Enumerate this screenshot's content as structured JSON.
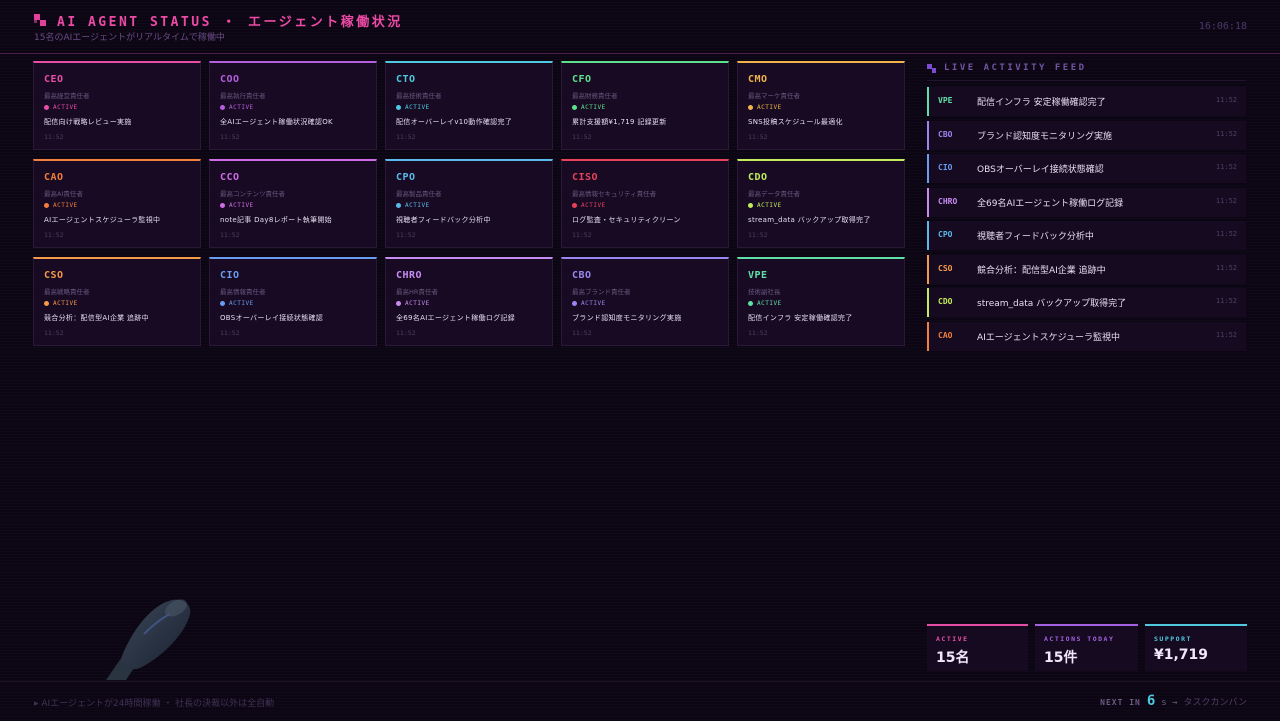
{
  "header": {
    "title": "AI AGENT STATUS ・ エージェント稼働状況",
    "subtitle": "15名のAIエージェントがリアルタイムで稼働中",
    "clock": "16:06:18"
  },
  "agents": [
    {
      "role": "CEO",
      "title": "最高経営責任者",
      "status": "ACTIVE",
      "task": "配信向け戦略レビュー実施",
      "time": "11:52",
      "color": "#e94ea6"
    },
    {
      "role": "COO",
      "title": "最高執行責任者",
      "status": "ACTIVE",
      "task": "全AIエージェント稼働状況確認OK",
      "time": "11:52",
      "color": "#b65ee0"
    },
    {
      "role": "CTO",
      "title": "最高技術責任者",
      "status": "ACTIVE",
      "task": "配信オーバーレイv10動作確認完了",
      "time": "11:52",
      "color": "#4fc9df"
    },
    {
      "role": "CFO",
      "title": "最高財務責任者",
      "status": "ACTIVE",
      "task": "累計支援額¥1,719 記録更新",
      "time": "11:52",
      "color": "#5de08a"
    },
    {
      "role": "CMO",
      "title": "最高マーケ責任者",
      "status": "ACTIVE",
      "task": "SNS投稿スケジュール最適化",
      "time": "11:52",
      "color": "#f0b34a"
    },
    {
      "role": "CAO",
      "title": "最高AI責任者",
      "status": "ACTIVE",
      "task": "AIエージェントスケジューラ監視中",
      "time": "11:52",
      "color": "#f07f3c"
    },
    {
      "role": "CCO",
      "title": "最高コンテンツ責任者",
      "status": "ACTIVE",
      "task": "note記事 Day8レポート執筆開始",
      "time": "11:52",
      "color": "#d06be8"
    },
    {
      "role": "CPO",
      "title": "最高製品責任者",
      "status": "ACTIVE",
      "task": "視聴者フィードバック分析中",
      "time": "11:52",
      "color": "#5ab8ea"
    },
    {
      "role": "CISO",
      "title": "最高情報セキュリティ責任者",
      "status": "ACTIVE",
      "task": "ログ監査・セキュリティクリーン",
      "time": "11:52",
      "color": "#e8425a"
    },
    {
      "role": "CDO",
      "title": "最高データ責任者",
      "status": "ACTIVE",
      "task": "stream_data バックアップ取得完了",
      "time": "11:52",
      "color": "#c3ec5c"
    },
    {
      "role": "CSO",
      "title": "最高戦略責任者",
      "status": "ACTIVE",
      "task": "競合分析：配信型AI企業 追跡中",
      "time": "11:52",
      "color": "#f59a48"
    },
    {
      "role": "CIO",
      "title": "最高情報責任者",
      "status": "ACTIVE",
      "task": "OBSオーバーレイ接続状態確認",
      "time": "11:52",
      "color": "#6a9cf0"
    },
    {
      "role": "CHRO",
      "title": "最高HR責任者",
      "status": "ACTIVE",
      "task": "全69名AIエージェント稼働ログ記録",
      "time": "11:52",
      "color": "#c78cf2"
    },
    {
      "role": "CBO",
      "title": "最高ブランド責任者",
      "status": "ACTIVE",
      "task": "ブランド認知度モニタリング実施",
      "time": "11:52",
      "color": "#9a86f0"
    },
    {
      "role": "VPE",
      "title": "技術副社長",
      "status": "ACTIVE",
      "task": "配信インフラ 安定稼働確認完了",
      "time": "11:52",
      "color": "#5fe0a8"
    }
  ],
  "feed": {
    "title": "LIVE ACTIVITY FEED",
    "items": [
      {
        "role": "VPE",
        "text": "配信インフラ 安定稼働確認完了",
        "time": "11:52",
        "color": "#5fe0a8"
      },
      {
        "role": "CBO",
        "text": "ブランド認知度モニタリング実施",
        "time": "11:52",
        "color": "#9a86f0"
      },
      {
        "role": "CIO",
        "text": "OBSオーバーレイ接続状態確認",
        "time": "11:52",
        "color": "#6a9cf0"
      },
      {
        "role": "CHRO",
        "text": "全69名AIエージェント稼働ログ記録",
        "time": "11:52",
        "color": "#c78cf2"
      },
      {
        "role": "CPO",
        "text": "視聴者フィードバック分析中",
        "time": "11:52",
        "color": "#5ab8ea"
      },
      {
        "role": "CSO",
        "text": "競合分析：配信型AI企業 追跡中",
        "time": "11:52",
        "color": "#f59a48"
      },
      {
        "role": "CDO",
        "text": "stream_data バックアップ取得完了",
        "time": "11:52",
        "color": "#c3ec5c"
      },
      {
        "role": "CAO",
        "text": "AIエージェントスケジューラ監視中",
        "time": "11:52",
        "color": "#f07f3c"
      }
    ]
  },
  "stats": [
    {
      "label": "ACTIVE",
      "value": "15名",
      "color": "#e94ea6"
    },
    {
      "label": "ACTIONS TODAY",
      "value": "15件",
      "color": "#a462e0"
    },
    {
      "label": "SUPPORT",
      "value": "¥1,719",
      "color": "#4fc9df"
    }
  ],
  "footer": {
    "left": "▸ AIエージェントが24時間稼働 ・ 社長の決裁以外は全自動",
    "next_label": "NEXT IN",
    "next_num": "6",
    "next_unit": "s →",
    "next_target": "タスクカンバン"
  }
}
